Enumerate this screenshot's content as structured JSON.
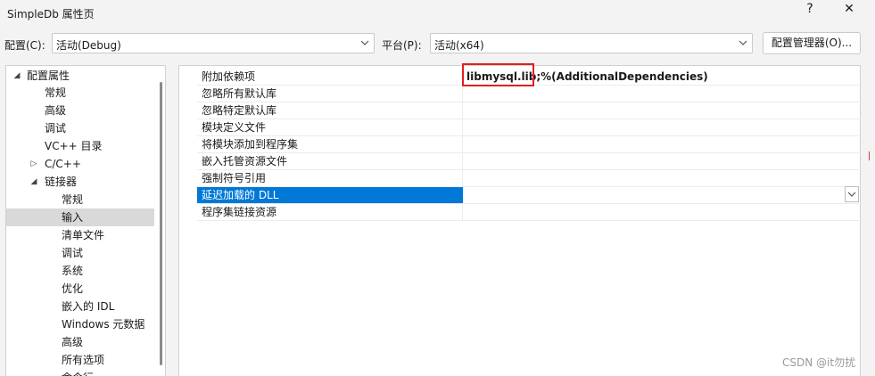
{
  "window": {
    "title": "SimpleDb 属性页",
    "help_glyph": "?",
    "close_glyph": "✕"
  },
  "config": {
    "config_label": "配置(C):",
    "config_value": "活动(Debug)",
    "platform_label": "平台(P):",
    "platform_value": "活动(x64)",
    "manager_button": "配置管理器(O)..."
  },
  "tree": {
    "items": [
      {
        "label": "配置属性",
        "arrow": "◢"
      },
      {
        "label": "常规"
      },
      {
        "label": "高级"
      },
      {
        "label": "调试"
      },
      {
        "label": "VC++ 目录"
      },
      {
        "label": "C/C++",
        "arrow": "▷"
      },
      {
        "label": "链接器",
        "arrow": "◢"
      },
      {
        "label": "常规"
      },
      {
        "label": "输入"
      },
      {
        "label": "清单文件"
      },
      {
        "label": "调试"
      },
      {
        "label": "系统"
      },
      {
        "label": "优化"
      },
      {
        "label": "嵌入的 IDL"
      },
      {
        "label": "Windows 元数据"
      },
      {
        "label": "高级"
      },
      {
        "label": "所有选项"
      },
      {
        "label": "命令行"
      }
    ]
  },
  "grid": {
    "rows": [
      {
        "name": "附加依赖项",
        "value": "libmysql.lib;%(AdditionalDependencies)"
      },
      {
        "name": "忽略所有默认库",
        "value": ""
      },
      {
        "name": "忽略特定默认库",
        "value": ""
      },
      {
        "name": "模块定义文件",
        "value": ""
      },
      {
        "name": "将模块添加到程序集",
        "value": ""
      },
      {
        "name": "嵌入托管资源文件",
        "value": ""
      },
      {
        "name": "强制符号引用",
        "value": ""
      },
      {
        "name": "延迟加载的 DLL",
        "value": ""
      },
      {
        "name": "程序集链接资源",
        "value": ""
      }
    ]
  },
  "watermark": "CSDN @it勿扰",
  "colors": {
    "selection": "#0078d7",
    "highlight_box": "#e02020"
  }
}
